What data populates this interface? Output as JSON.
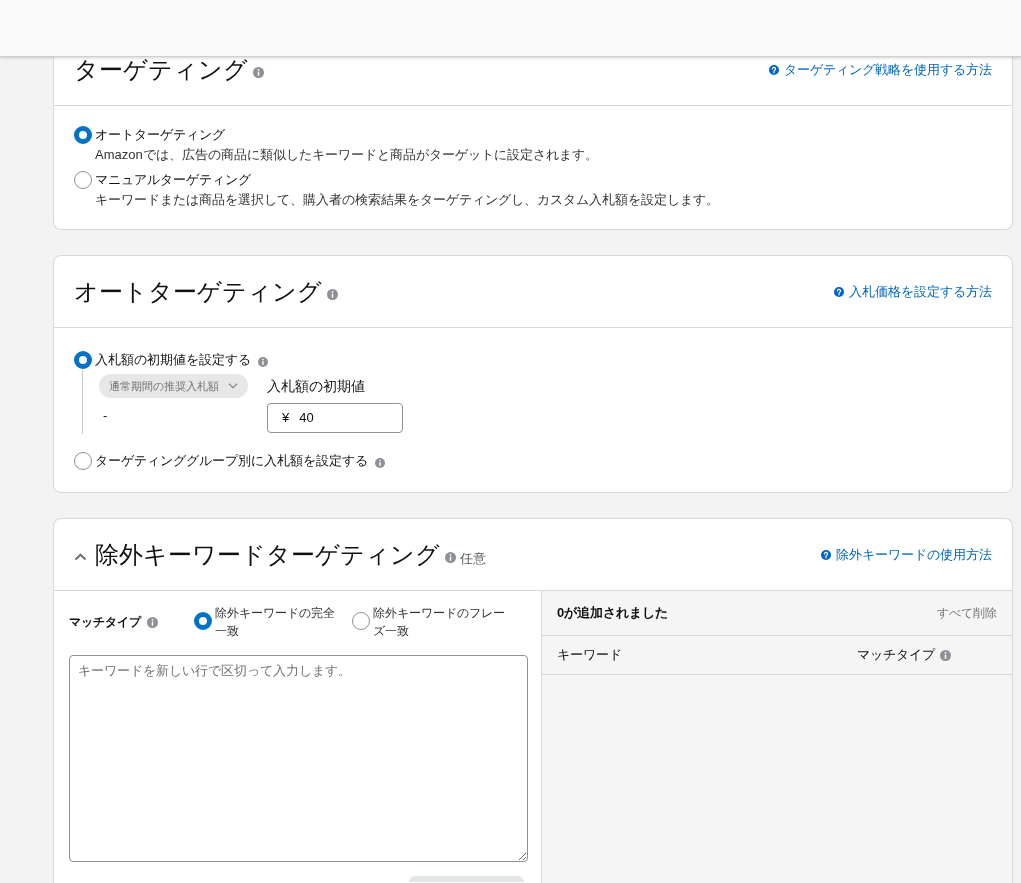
{
  "targeting": {
    "title": "ターゲティング",
    "help_link": "ターゲティング戦略を使用する方法",
    "options": [
      {
        "label": "オートターゲティング",
        "description": "Amazonでは、広告の商品に類似したキーワードと商品がターゲットに設定されます。",
        "selected": true
      },
      {
        "label": "マニュアルターゲティング",
        "description": "キーワードまたは商品を選択して、購入者の検索結果をターゲティングし、カスタム入札額を設定します。",
        "selected": false
      }
    ]
  },
  "auto_targeting": {
    "title": "オートターゲティング",
    "help_link": "入札価格を設定する方法",
    "options": [
      {
        "label": "入札額の初期値を設定する",
        "selected": true,
        "suggested_bid": {
          "dropdown": "通常期間の推奨入札額",
          "value": "-"
        },
        "default_bid": {
          "label": "入札額の初期値",
          "currency": "¥",
          "value": "40"
        }
      },
      {
        "label": "ターゲティンググループ別に入札額を設定する",
        "selected": false
      }
    ]
  },
  "negative_keywords": {
    "title": "除外キーワードターゲティング",
    "optional_label": "任意",
    "expanded": true,
    "help_link": "除外キーワードの使用方法",
    "match_type": {
      "label": "マッチタイプ",
      "options": [
        {
          "label": "除外キーワードの完全一致",
          "selected": true
        },
        {
          "label": "除外キーワードのフレーズ一致",
          "selected": false
        }
      ]
    },
    "keywords_input": {
      "placeholder": "キーワードを新しい行で区切って入力します。"
    },
    "added_list": {
      "title": "0が追加されました",
      "remove_all": "すべて削除",
      "columns": [
        {
          "label": "キーワード"
        },
        {
          "label": "マッチタイプ"
        }
      ]
    }
  }
}
